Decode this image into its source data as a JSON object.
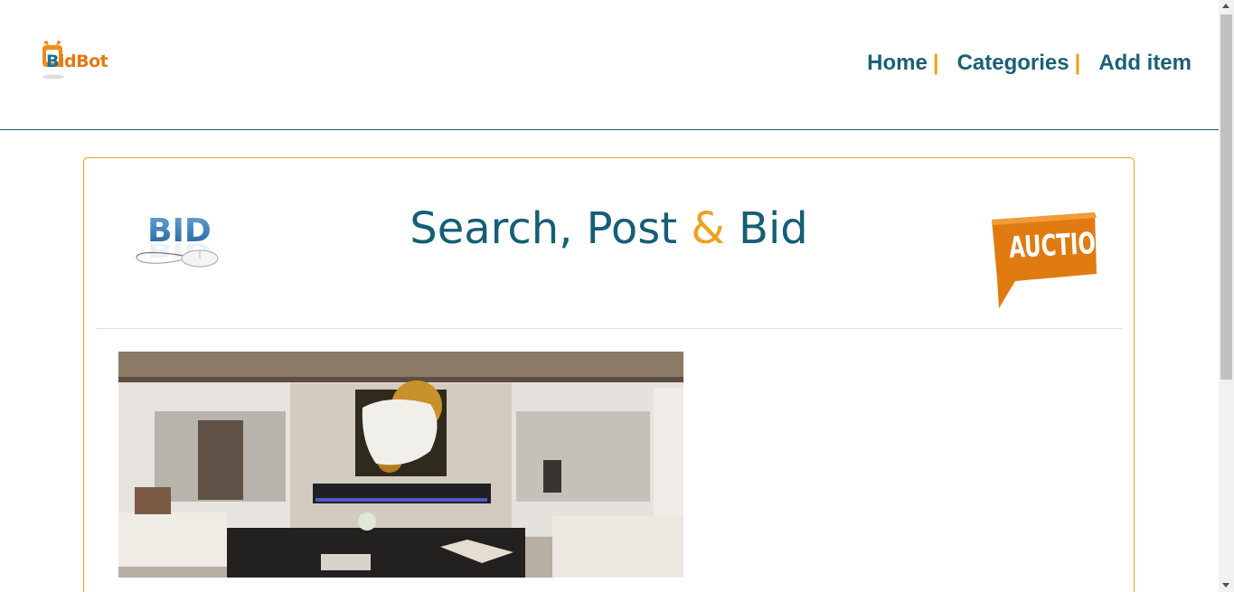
{
  "logo": {
    "first_letter": "B",
    "rest": "idBot"
  },
  "nav": {
    "items": [
      {
        "label": "Home",
        "separator": "|"
      },
      {
        "label": "Categories",
        "separator": "|"
      },
      {
        "label": "Add item",
        "separator": ""
      }
    ]
  },
  "hero": {
    "title_part1": "Search, Post ",
    "title_amp": "&",
    "title_part2": " Bid"
  },
  "bid_icon": {
    "text": "BID"
  },
  "auction_icon": {
    "text": "AUCTION"
  },
  "colors": {
    "brand_teal": "#155f76",
    "accent_orange": "#f0a022",
    "card_border": "#e8a020"
  }
}
